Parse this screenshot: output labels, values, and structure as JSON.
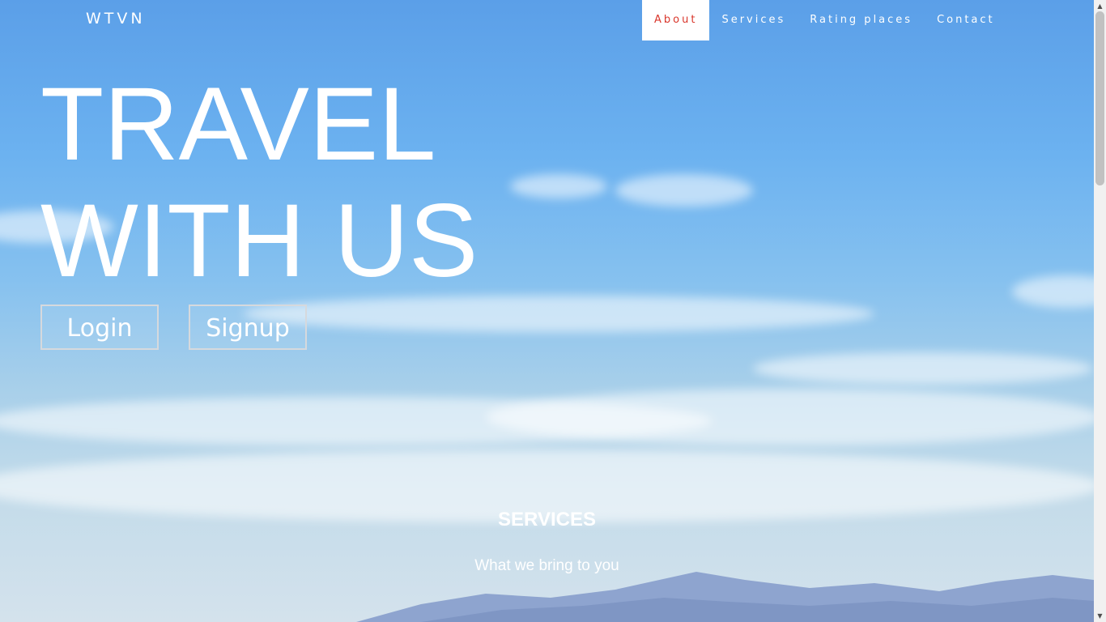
{
  "navbar": {
    "brand": "WTVN",
    "items": [
      {
        "label": "About",
        "active": true
      },
      {
        "label": "Services",
        "active": false
      },
      {
        "label": "Rating places",
        "active": false
      },
      {
        "label": "Contact",
        "active": false
      }
    ]
  },
  "hero": {
    "headline_line1": "TRAVEL",
    "headline_line2": "WITH US",
    "login_label": "Login",
    "signup_label": "Signup"
  },
  "services": {
    "title": "SERVICES",
    "subtitle": "What we bring to you"
  },
  "colors": {
    "sky_top": "#5b9fe8",
    "sky_bottom": "#d4e2ec",
    "active_nav_text": "#d9362b",
    "active_nav_bg": "#ffffff",
    "text": "#ffffff"
  },
  "icons": {
    "scroll_up": "scroll-up-arrow-icon",
    "scroll_down": "scroll-down-arrow-icon"
  }
}
